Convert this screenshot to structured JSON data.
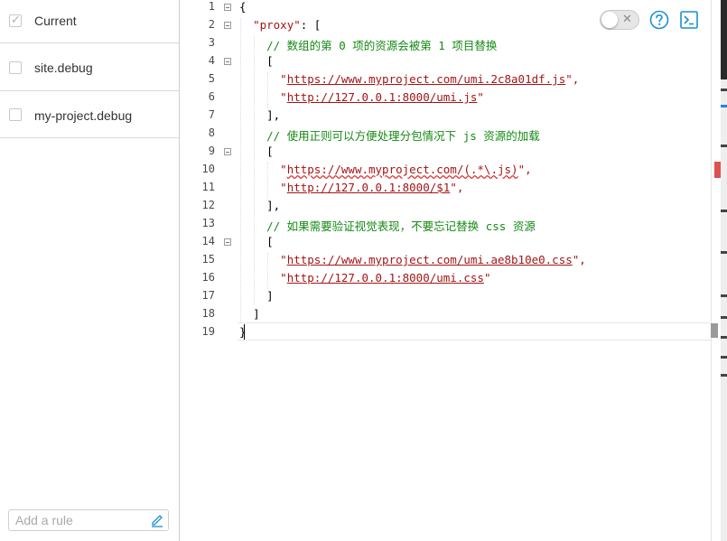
{
  "sidebar": {
    "rules": [
      {
        "label": "Current",
        "checked": true
      },
      {
        "label": "site.debug",
        "checked": false
      },
      {
        "label": "my-project.debug",
        "checked": false
      }
    ],
    "add_rule_placeholder": "Add a rule"
  },
  "editor": {
    "line_numbers": [
      "1",
      "2",
      "3",
      "4",
      "5",
      "6",
      "7",
      "8",
      "9",
      "10",
      "11",
      "12",
      "13",
      "14",
      "15",
      "16",
      "17",
      "18",
      "19"
    ],
    "folds": [
      1,
      2,
      4,
      9,
      14
    ],
    "lines": {
      "l1": "{",
      "l2_key": "\"proxy\"",
      "l2_rest": ": [",
      "l3": "// 数组的第 0 项的资源会被第 1 项目替换",
      "l4": "[",
      "l5_q": "\"",
      "l5_url": "https://www.myproject.com/umi.2c8a01df.js",
      "l5_end": "\",",
      "l6_q": "\"",
      "l6_url": "http://127.0.0.1:8000/umi.js",
      "l6_end": "\"",
      "l7": "],",
      "l8": "// 使用正则可以方便处理分包情况下 js 资源的加载",
      "l9": "[",
      "l10_q": "\"",
      "l10_url": "https://www.myproject.com/",
      "l10_re": "(.*\\.js)",
      "l10_end": "\",",
      "l11_q": "\"",
      "l11_url": "http://127.0.0.1:8000/$1",
      "l11_end": "\",",
      "l12": "],",
      "l13": "// 如果需要验证视觉表现，不要忘记替换 css 资源",
      "l14": "[",
      "l15_q": "\"",
      "l15_url": "https://www.myproject.com/umi.ae8b10e0.css",
      "l15_end": "\",",
      "l16_q": "\"",
      "l16_url": "http://127.0.0.1:8000/umi.css",
      "l16_end": "\"",
      "l17": "]",
      "l18": "]",
      "l19": "}"
    }
  },
  "toolbar": {
    "toggle_on": false,
    "toggle_icon": "close-icon",
    "help_icon": "help-circle-icon",
    "terminal_icon": "terminal-icon"
  },
  "colors": {
    "string": "#a31515",
    "comment": "#148a14",
    "accent": "#1a8fd6"
  }
}
